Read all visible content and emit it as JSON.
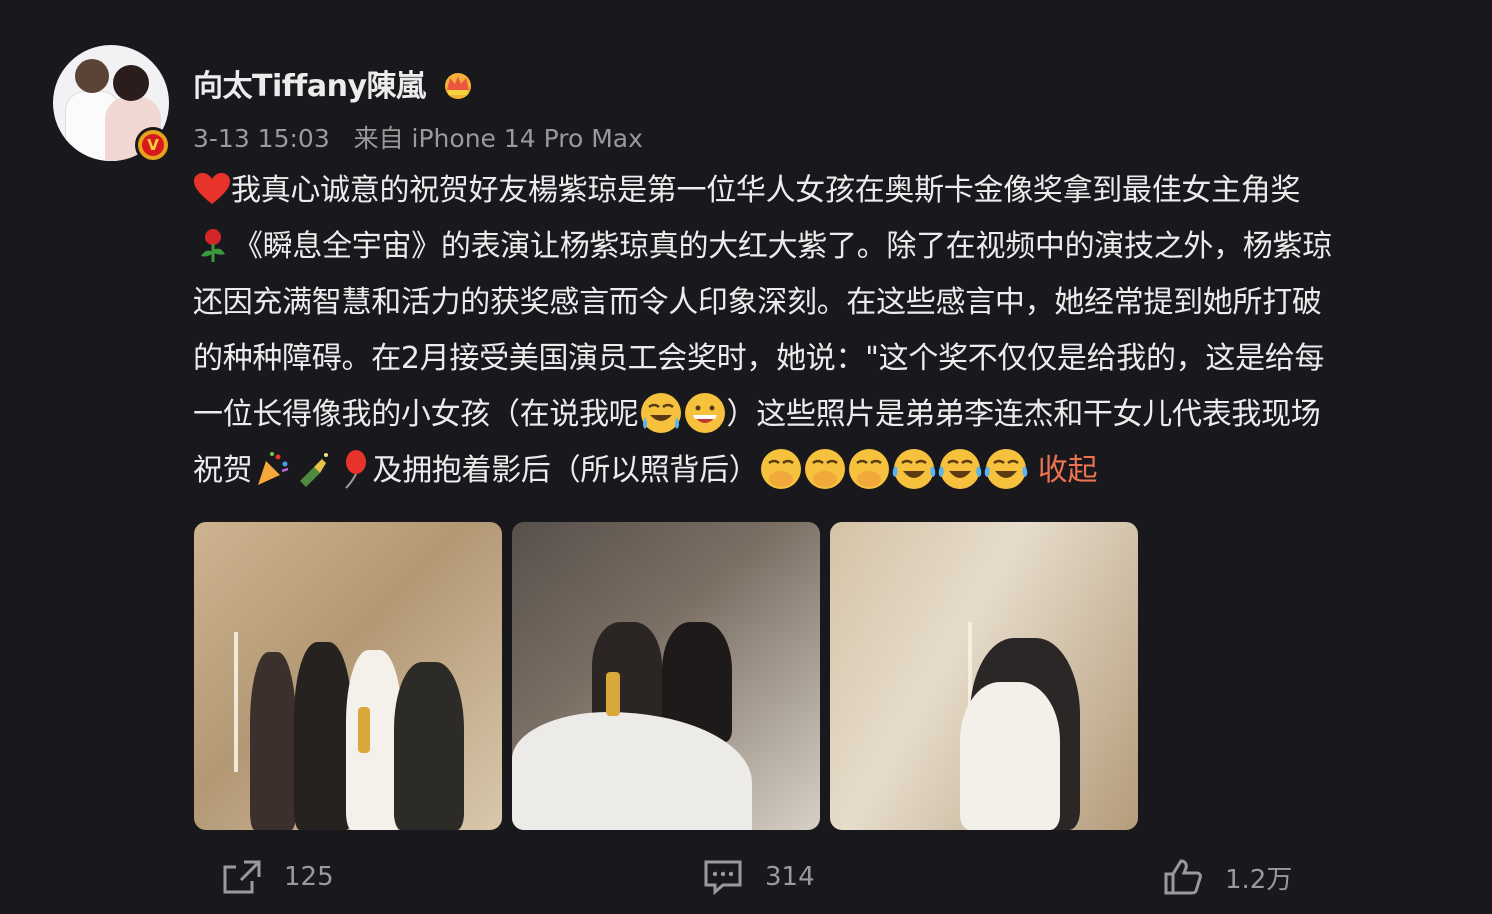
{
  "post": {
    "username": "向太Tiffany陳嵐",
    "time": "3-13 15:03",
    "source": "来自 iPhone 14 Pro Max",
    "lines": [
      "我真心诚意的祝贺好友楊紫琼是第一位华人女孩在奥斯卡金像奖拿到最佳女主角奖",
      "《瞬息全宇宙》的表演让杨紫琼真的大红大紫了。除了在视频中的演技之外，杨紫琼",
      "还因充满智慧和活力的获奖感言而令人印象深刻。在这些感言中，她经常提到她所打破",
      "的种种障碍。在2月接受美国演员工会奖时，她说：\"这个奖不仅仅是给我的，这是给每",
      "一位长得像我的小女孩（在说我呢",
      "）这些照片是弟弟李连杰和干女儿代表我现场",
      "祝贺",
      "及拥抱着影后（所以照背后）"
    ],
    "collapse_label": "收起"
  },
  "actions": {
    "share_count": "125",
    "comment_count": "314",
    "like_count": "1.2万"
  },
  "icons": {
    "verified": "verified-v-badge-icon",
    "crown": "crown-icon",
    "share": "share-icon",
    "comment": "comment-icon",
    "like": "like-thumb-icon"
  },
  "colors": {
    "background": "#19181d",
    "collapse": "#eb7350",
    "verified": "#d8191d"
  }
}
